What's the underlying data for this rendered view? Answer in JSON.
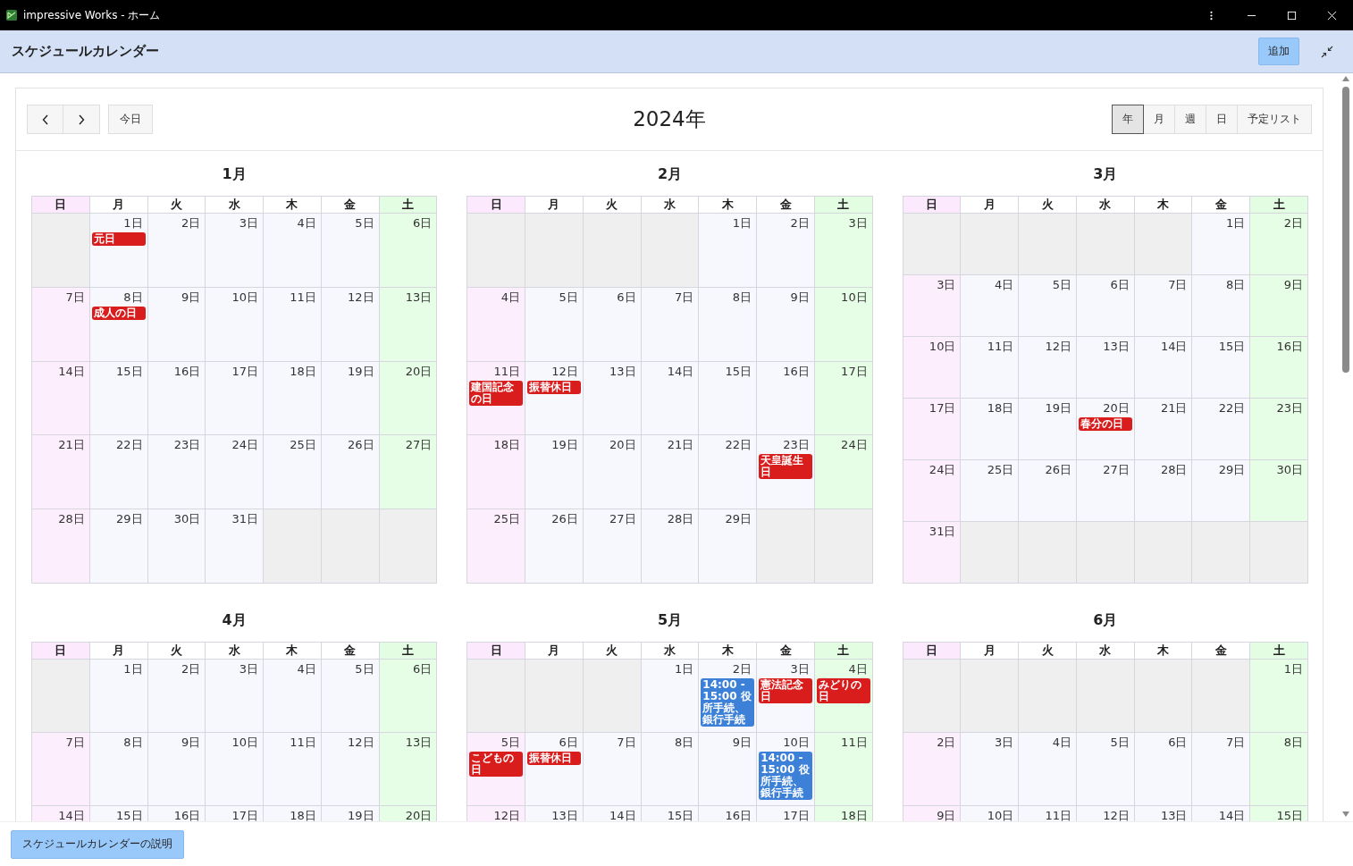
{
  "window": {
    "title": "impressive Works - ホーム"
  },
  "header": {
    "title": "スケジュールカレンダー",
    "add_button": "追加"
  },
  "toolbar": {
    "today_button": "今日",
    "title": "2024年",
    "views": [
      {
        "label": "年",
        "selected": true
      },
      {
        "label": "月",
        "selected": false
      },
      {
        "label": "週",
        "selected": false
      },
      {
        "label": "日",
        "selected": false
      },
      {
        "label": "予定リスト",
        "selected": false
      }
    ]
  },
  "months": [
    {
      "title": "1月",
      "weekdays": [
        "日",
        "月",
        "火",
        "水",
        "木",
        "金",
        "土"
      ],
      "weeks": [
        [
          {
            "outside": true
          },
          {
            "day": "1日",
            "outside": false,
            "events": [
              {
                "kind": "holiday",
                "label": "元日"
              }
            ]
          },
          {
            "day": "2日",
            "outside": false
          },
          {
            "day": "3日",
            "outside": false
          },
          {
            "day": "4日",
            "outside": false
          },
          {
            "day": "5日",
            "outside": false
          },
          {
            "day": "6日",
            "outside": false
          }
        ],
        [
          {
            "day": "7日",
            "outside": false
          },
          {
            "day": "8日",
            "outside": false,
            "events": [
              {
                "kind": "holiday",
                "label": "成人の日"
              }
            ]
          },
          {
            "day": "9日",
            "outside": false
          },
          {
            "day": "10日",
            "outside": false
          },
          {
            "day": "11日",
            "outside": false
          },
          {
            "day": "12日",
            "outside": false
          },
          {
            "day": "13日",
            "outside": false
          }
        ],
        [
          {
            "day": "14日",
            "outside": false
          },
          {
            "day": "15日",
            "outside": false
          },
          {
            "day": "16日",
            "outside": false
          },
          {
            "day": "17日",
            "outside": false
          },
          {
            "day": "18日",
            "outside": false
          },
          {
            "day": "19日",
            "outside": false
          },
          {
            "day": "20日",
            "outside": false
          }
        ],
        [
          {
            "day": "21日",
            "outside": false
          },
          {
            "day": "22日",
            "outside": false
          },
          {
            "day": "23日",
            "outside": false
          },
          {
            "day": "24日",
            "outside": false
          },
          {
            "day": "25日",
            "outside": false
          },
          {
            "day": "26日",
            "outside": false
          },
          {
            "day": "27日",
            "outside": false
          }
        ],
        [
          {
            "day": "28日",
            "outside": false
          },
          {
            "day": "29日",
            "outside": false
          },
          {
            "day": "30日",
            "outside": false
          },
          {
            "day": "31日",
            "outside": false
          },
          {
            "outside": true
          },
          {
            "outside": true
          },
          {
            "outside": true
          }
        ]
      ]
    },
    {
      "title": "2月",
      "weekdays": [
        "日",
        "月",
        "火",
        "水",
        "木",
        "金",
        "土"
      ],
      "weeks": [
        [
          {
            "outside": true
          },
          {
            "outside": true
          },
          {
            "outside": true
          },
          {
            "outside": true
          },
          {
            "day": "1日",
            "outside": false
          },
          {
            "day": "2日",
            "outside": false
          },
          {
            "day": "3日",
            "outside": false
          }
        ],
        [
          {
            "day": "4日",
            "outside": false
          },
          {
            "day": "5日",
            "outside": false
          },
          {
            "day": "6日",
            "outside": false
          },
          {
            "day": "7日",
            "outside": false
          },
          {
            "day": "8日",
            "outside": false
          },
          {
            "day": "9日",
            "outside": false
          },
          {
            "day": "10日",
            "outside": false
          }
        ],
        [
          {
            "day": "11日",
            "outside": false,
            "events": [
              {
                "kind": "holiday",
                "label": "建国記念の日"
              }
            ]
          },
          {
            "day": "12日",
            "outside": false,
            "events": [
              {
                "kind": "holiday",
                "label": "振替休日"
              }
            ]
          },
          {
            "day": "13日",
            "outside": false
          },
          {
            "day": "14日",
            "outside": false
          },
          {
            "day": "15日",
            "outside": false
          },
          {
            "day": "16日",
            "outside": false
          },
          {
            "day": "17日",
            "outside": false
          }
        ],
        [
          {
            "day": "18日",
            "outside": false
          },
          {
            "day": "19日",
            "outside": false
          },
          {
            "day": "20日",
            "outside": false
          },
          {
            "day": "21日",
            "outside": false
          },
          {
            "day": "22日",
            "outside": false
          },
          {
            "day": "23日",
            "outside": false,
            "events": [
              {
                "kind": "holiday",
                "label": "天皇誕生日"
              }
            ]
          },
          {
            "day": "24日",
            "outside": false
          }
        ],
        [
          {
            "day": "25日",
            "outside": false
          },
          {
            "day": "26日",
            "outside": false
          },
          {
            "day": "27日",
            "outside": false
          },
          {
            "day": "28日",
            "outside": false
          },
          {
            "day": "29日",
            "outside": false
          },
          {
            "outside": true
          },
          {
            "outside": true
          }
        ]
      ]
    },
    {
      "title": "3月",
      "weekdays": [
        "日",
        "月",
        "火",
        "水",
        "木",
        "金",
        "土"
      ],
      "weeks": [
        [
          {
            "outside": true
          },
          {
            "outside": true
          },
          {
            "outside": true
          },
          {
            "outside": true
          },
          {
            "outside": true
          },
          {
            "day": "1日",
            "outside": false
          },
          {
            "day": "2日",
            "outside": false
          }
        ],
        [
          {
            "day": "3日",
            "outside": false
          },
          {
            "day": "4日",
            "outside": false
          },
          {
            "day": "5日",
            "outside": false
          },
          {
            "day": "6日",
            "outside": false
          },
          {
            "day": "7日",
            "outside": false
          },
          {
            "day": "8日",
            "outside": false
          },
          {
            "day": "9日",
            "outside": false
          }
        ],
        [
          {
            "day": "10日",
            "outside": false
          },
          {
            "day": "11日",
            "outside": false
          },
          {
            "day": "12日",
            "outside": false
          },
          {
            "day": "13日",
            "outside": false
          },
          {
            "day": "14日",
            "outside": false
          },
          {
            "day": "15日",
            "outside": false
          },
          {
            "day": "16日",
            "outside": false
          }
        ],
        [
          {
            "day": "17日",
            "outside": false
          },
          {
            "day": "18日",
            "outside": false
          },
          {
            "day": "19日",
            "outside": false
          },
          {
            "day": "20日",
            "outside": false,
            "events": [
              {
                "kind": "holiday",
                "label": "春分の日"
              }
            ]
          },
          {
            "day": "21日",
            "outside": false
          },
          {
            "day": "22日",
            "outside": false
          },
          {
            "day": "23日",
            "outside": false
          }
        ],
        [
          {
            "day": "24日",
            "outside": false
          },
          {
            "day": "25日",
            "outside": false
          },
          {
            "day": "26日",
            "outside": false
          },
          {
            "day": "27日",
            "outside": false
          },
          {
            "day": "28日",
            "outside": false
          },
          {
            "day": "29日",
            "outside": false
          },
          {
            "day": "30日",
            "outside": false
          }
        ],
        [
          {
            "day": "31日",
            "outside": false
          },
          {
            "outside": true
          },
          {
            "outside": true
          },
          {
            "outside": true
          },
          {
            "outside": true
          },
          {
            "outside": true
          },
          {
            "outside": true
          }
        ]
      ]
    },
    {
      "title": "4月",
      "weekdays": [
        "日",
        "月",
        "火",
        "水",
        "木",
        "金",
        "土"
      ],
      "weeks": [
        [
          {
            "outside": true
          },
          {
            "day": "1日",
            "outside": false
          },
          {
            "day": "2日",
            "outside": false
          },
          {
            "day": "3日",
            "outside": false
          },
          {
            "day": "4日",
            "outside": false
          },
          {
            "day": "5日",
            "outside": false
          },
          {
            "day": "6日",
            "outside": false
          }
        ],
        [
          {
            "day": "7日",
            "outside": false
          },
          {
            "day": "8日",
            "outside": false
          },
          {
            "day": "9日",
            "outside": false
          },
          {
            "day": "10日",
            "outside": false
          },
          {
            "day": "11日",
            "outside": false
          },
          {
            "day": "12日",
            "outside": false
          },
          {
            "day": "13日",
            "outside": false
          }
        ],
        [
          {
            "day": "14日",
            "outside": false
          },
          {
            "day": "15日",
            "outside": false
          },
          {
            "day": "16日",
            "outside": false
          },
          {
            "day": "17日",
            "outside": false
          },
          {
            "day": "18日",
            "outside": false
          },
          {
            "day": "19日",
            "outside": false
          },
          {
            "day": "20日",
            "outside": false
          }
        ]
      ]
    },
    {
      "title": "5月",
      "weekdays": [
        "日",
        "月",
        "火",
        "水",
        "木",
        "金",
        "土"
      ],
      "weeks": [
        [
          {
            "outside": true
          },
          {
            "outside": true
          },
          {
            "outside": true
          },
          {
            "day": "1日",
            "outside": false
          },
          {
            "day": "2日",
            "outside": false,
            "events": [
              {
                "kind": "appointment",
                "label": "14:00 - 15:00 役所手続、銀行手続"
              }
            ]
          },
          {
            "day": "3日",
            "outside": false,
            "events": [
              {
                "kind": "holiday",
                "label": "憲法記念日"
              }
            ]
          },
          {
            "day": "4日",
            "outside": false,
            "events": [
              {
                "kind": "holiday",
                "label": "みどりの日"
              }
            ]
          }
        ],
        [
          {
            "day": "5日",
            "outside": false,
            "events": [
              {
                "kind": "holiday",
                "label": "こどもの日"
              }
            ]
          },
          {
            "day": "6日",
            "outside": false,
            "events": [
              {
                "kind": "holiday",
                "label": "振替休日"
              }
            ]
          },
          {
            "day": "7日",
            "outside": false
          },
          {
            "day": "8日",
            "outside": false
          },
          {
            "day": "9日",
            "outside": false
          },
          {
            "day": "10日",
            "outside": false,
            "events": [
              {
                "kind": "appointment",
                "label": "14:00 - 15:00 役所手続、銀行手続"
              }
            ]
          },
          {
            "day": "11日",
            "outside": false
          }
        ],
        [
          {
            "day": "12日",
            "outside": false
          },
          {
            "day": "13日",
            "outside": false
          },
          {
            "day": "14日",
            "outside": false
          },
          {
            "day": "15日",
            "outside": false
          },
          {
            "day": "16日",
            "outside": false
          },
          {
            "day": "17日",
            "outside": false
          },
          {
            "day": "18日",
            "outside": false
          }
        ]
      ]
    },
    {
      "title": "6月",
      "weekdays": [
        "日",
        "月",
        "火",
        "水",
        "木",
        "金",
        "土"
      ],
      "weeks": [
        [
          {
            "outside": true
          },
          {
            "outside": true
          },
          {
            "outside": true
          },
          {
            "outside": true
          },
          {
            "outside": true
          },
          {
            "outside": true
          },
          {
            "day": "1日",
            "outside": false
          }
        ],
        [
          {
            "day": "2日",
            "outside": false
          },
          {
            "day": "3日",
            "outside": false
          },
          {
            "day": "4日",
            "outside": false
          },
          {
            "day": "5日",
            "outside": false
          },
          {
            "day": "6日",
            "outside": false
          },
          {
            "day": "7日",
            "outside": false
          },
          {
            "day": "8日",
            "outside": false
          }
        ],
        [
          {
            "day": "9日",
            "outside": false
          },
          {
            "day": "10日",
            "outside": false
          },
          {
            "day": "11日",
            "outside": false
          },
          {
            "day": "12日",
            "outside": false
          },
          {
            "day": "13日",
            "outside": false
          },
          {
            "day": "14日",
            "outside": false
          },
          {
            "day": "15日",
            "outside": false
          }
        ]
      ]
    }
  ],
  "footer": {
    "help_button": "スケジュールカレンダーの説明"
  }
}
